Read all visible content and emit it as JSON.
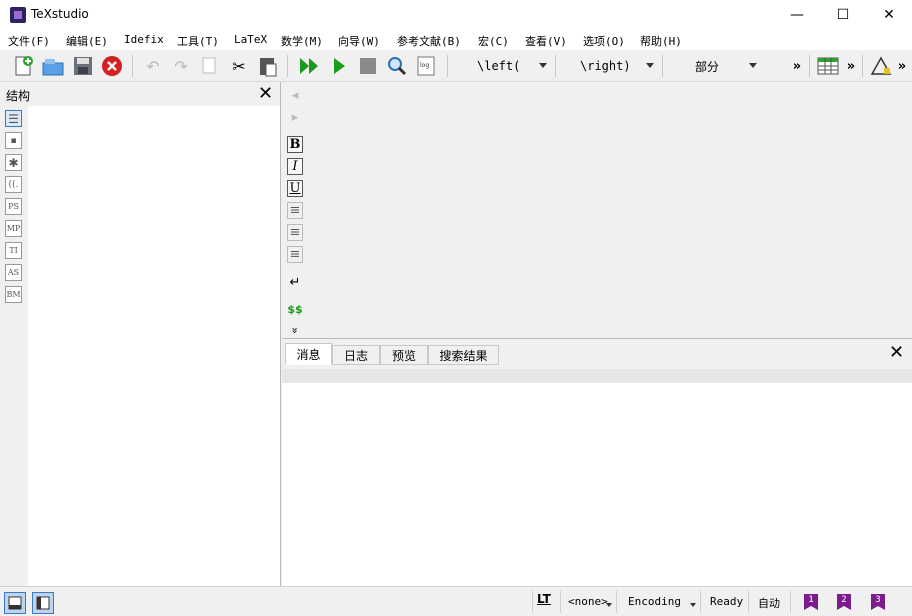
{
  "window": {
    "title": "TeXstudio",
    "minimize": "—",
    "maximize": "☐",
    "close": "✕"
  },
  "menubar": {
    "items": [
      "文件(F)",
      "编辑(E)",
      "Idefix",
      "工具(T)",
      "LaTeX",
      "数学(M)",
      "向导(W)",
      "参考文献(B)",
      "宏(C)",
      "查看(V)",
      "选项(O)",
      "帮助(H)"
    ]
  },
  "toolbar": {
    "combo_left": "\\left(",
    "combo_right": "\\right)",
    "combo_section": "部分",
    "overflow": "»",
    "log_label": "log"
  },
  "structure": {
    "title": "结构",
    "close": "✕",
    "strip": [
      "☰",
      "▪",
      "✱",
      "((.",
      "PS",
      "MP",
      "TI",
      "AS",
      "BM"
    ]
  },
  "editor": {
    "format_buttons": [
      "B",
      "I",
      "U",
      "≡",
      "≡",
      "≡",
      "↵",
      "$$",
      "»"
    ]
  },
  "messages": {
    "tabs": [
      "消息",
      "日志",
      "预览",
      "搜索结果"
    ],
    "close": "✕"
  },
  "statusbar": {
    "lt": "LT",
    "language": "<none>",
    "encoding": "Encoding",
    "status": "Ready",
    "mode": "自动",
    "bookmarks": [
      "1",
      "2",
      "3"
    ]
  },
  "colors": {
    "accent": "#7a1c8c",
    "run_green": "#1b9b1b",
    "stop_red": "#d32020"
  }
}
